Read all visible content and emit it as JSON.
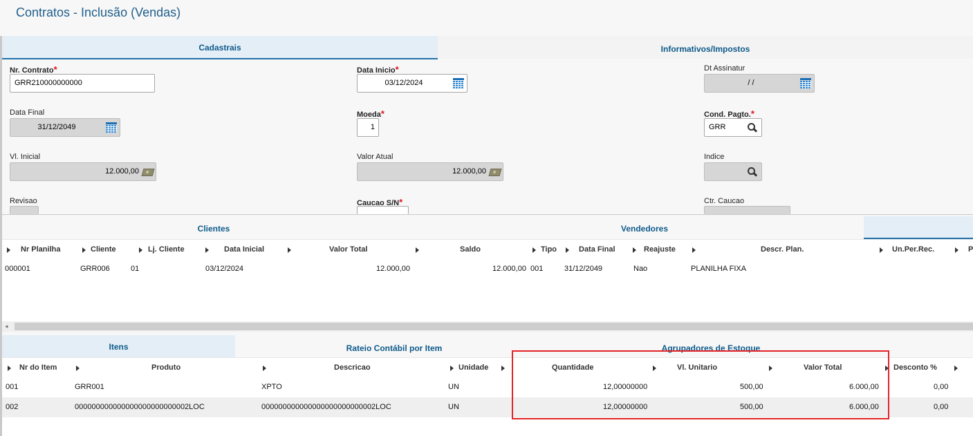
{
  "page_title": "Contratos - Inclusão (Vendas)",
  "top_tabs": [
    "Cadastrais",
    "Informativos/Impostos"
  ],
  "form": {
    "nr_contrato": {
      "label": "Nr. Contrato",
      "value": "GRR210000000000"
    },
    "data_inicio": {
      "label": "Data Inicio",
      "value": "03/12/2024"
    },
    "dt_assinatur": {
      "label": "Dt Assinatur",
      "value": "/ /"
    },
    "data_final": {
      "label": "Data Final",
      "value": "31/12/2049"
    },
    "moeda": {
      "label": "Moeda",
      "value": "1"
    },
    "cond_pagto": {
      "label": "Cond. Pagto.",
      "value": "GRR"
    },
    "vl_inicial": {
      "label": "Vl. Inicial",
      "value": "12.000,00"
    },
    "valor_atual": {
      "label": "Valor Atual",
      "value": "12.000,00"
    },
    "indice": {
      "label": "Indice",
      "value": ""
    },
    "revisao": {
      "label": "Revisao",
      "value": ""
    },
    "caucao": {
      "label": "Caucao S/N",
      "value": ""
    },
    "ctr_caucao": {
      "label": "Ctr. Caucao",
      "value": ""
    }
  },
  "mid_tabs": [
    "Clientes",
    "Vendedores"
  ],
  "planilha_grid": {
    "headers": [
      "Nr Planilha",
      "Cliente",
      "Lj. Cliente",
      "Data Inicial",
      "Valor Total",
      "Saldo",
      "Tipo",
      "Data Final",
      "Reajuste",
      "Descr. Plan.",
      "Un.Per.Rec.",
      "P"
    ],
    "rows": [
      [
        "000001",
        "GRR006",
        "01",
        "03/12/2024",
        "12.000,00",
        "12.000,00",
        "001",
        "31/12/2049",
        "Nao",
        "PLANILHA FIXA",
        "",
        ""
      ]
    ]
  },
  "bottom_tabs": [
    "Itens",
    "Rateio Contábil por Item",
    "Agrupadores de Estoque"
  ],
  "items_grid": {
    "headers": [
      "Nr do Item",
      "Produto",
      "Descricao",
      "Unidade",
      "Quantidade",
      "Vl. Unitario",
      "Valor Total",
      "Desconto %"
    ],
    "rows": [
      [
        "001",
        "GRR001",
        "XPTO",
        "UN",
        "12,00000000",
        "500,00",
        "6.000,00",
        "0,00"
      ],
      [
        "002",
        "000000000000000000000000002LOC",
        "000000000000000000000000002LOC",
        "UN",
        "12,00000000",
        "500,00",
        "6.000,00",
        "0,00"
      ]
    ]
  },
  "scroll_left_glyph": "◂",
  "colors": {
    "accent": "#1f6fa8",
    "highlight_box": "#e32227",
    "required": "#e0141e"
  }
}
